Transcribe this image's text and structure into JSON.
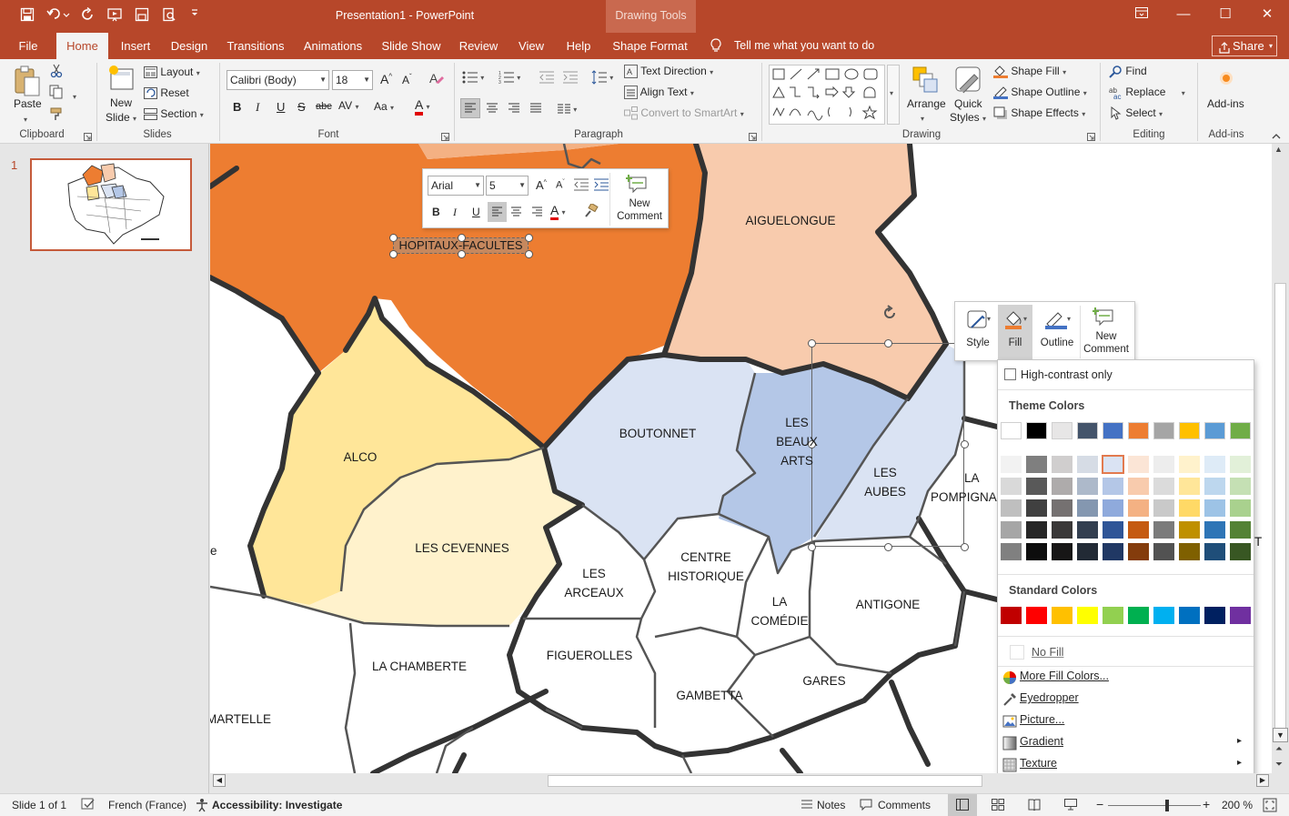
{
  "window": {
    "title": "Presentation1  -  PowerPoint",
    "context_tab_group": "Drawing Tools",
    "minimize": "—",
    "maximize": "☐",
    "close": "✕",
    "restore": "⧉"
  },
  "tabs": [
    "File",
    "Home",
    "Insert",
    "Design",
    "Transitions",
    "Animations",
    "Slide Show",
    "Review",
    "View",
    "Help",
    "Shape Format"
  ],
  "tell_me": "Tell me what you want to do",
  "share": "Share",
  "ribbon": {
    "clipboard": {
      "paste": "Paste",
      "label": "Clipboard"
    },
    "slides": {
      "new_slide_1": "New",
      "new_slide_2": "Slide",
      "layout": "Layout",
      "reset": "Reset",
      "section": "Section",
      "label": "Slides"
    },
    "font": {
      "name": "Calibri (Body)",
      "size": "18",
      "label": "Font",
      "bold": "B",
      "italic": "I",
      "underline": "U",
      "strike": "S",
      "shadow": "abc",
      "spacing": "AV",
      "case": "Aa",
      "color": "A",
      "grow": "A",
      "shrink": "A"
    },
    "paragraph": {
      "text_direction": "Text Direction",
      "align_text": "Align Text",
      "convert_smartart": "Convert to SmartArt",
      "label": "Paragraph"
    },
    "drawing": {
      "arrange": "Arrange",
      "quick_styles_1": "Quick",
      "quick_styles_2": "Styles",
      "shape_fill": "Shape Fill",
      "shape_outline": "Shape Outline",
      "shape_effects": "Shape Effects",
      "label": "Drawing"
    },
    "editing": {
      "find": "Find",
      "replace": "Replace",
      "select": "Select",
      "label": "Editing"
    },
    "addins": {
      "addins": "Add-ins",
      "label": "Add-ins"
    }
  },
  "slide_panel": {
    "number": "1"
  },
  "map": {
    "regions": [
      "AIGUELONGUE",
      "HOPITAUX-FACULTES",
      "ALCO",
      "LES CEVENNES",
      "BOUTONNET",
      "LES BEAUX ARTS",
      "LES AUBES",
      "LA POMPIGNANE",
      "LES ARCEAUX",
      "CENTRE HISTORIQUE",
      "LA COMÉDIE",
      "ANTIGONE",
      "FIGUEROLLES",
      "LA CHAMBERTE",
      "GAMBETTA",
      "GARES",
      "MARTELLE"
    ],
    "labels": {
      "aiguelongue": "AIGUELONGUE",
      "hopitaux": "HOPITAUX-FACULTES",
      "alco": "ALCO",
      "cevennes": "LES CEVENNES",
      "boutonnet": "BOUTONNET",
      "beauxarts_1": "LES",
      "beauxarts_2": "BEAUX",
      "beauxarts_3": "ARTS",
      "aubes_1": "LES",
      "aubes_2": "AUBES",
      "pompignane_1": "LA",
      "pompignane_2": "POMPIGNA",
      "arceaux_1": "LES",
      "arceaux_2": "ARCEAUX",
      "centre_1": "CENTRE",
      "centre_2": "HISTORIQUE",
      "comedie_1": "LA",
      "comedie_2": "COMÉDIE",
      "antigone": "ANTIGONE",
      "figuerolles": "FIGUEROLLES",
      "chamberte": "LA CHAMBERTE",
      "gambetta": "GAMBETTA",
      "gares": "GARES",
      "martelle": "MARTELLE",
      "edge_e": "e",
      "edge_t": "T"
    }
  },
  "mini_toolbar": {
    "font": "Arial",
    "size": "5",
    "new_comment_1": "New",
    "new_comment_2": "Comment"
  },
  "shape_toolbar": {
    "style": "Style",
    "fill": "Fill",
    "outline": "Outline",
    "new_comment_1": "New",
    "new_comment_2": "Comment"
  },
  "fill_menu": {
    "high_contrast": "High-contrast only",
    "theme_colors_header": "Theme Colors",
    "standard_colors_header": "Standard Colors",
    "no_fill": "No Fill",
    "more_fill_colors": "More Fill Colors...",
    "eyedropper": "Eyedropper",
    "picture": "Picture...",
    "gradient": "Gradient",
    "texture": "Texture",
    "theme_top": [
      "#ffffff",
      "#000000",
      "#e7e6e6",
      "#44546a",
      "#4472c4",
      "#ed7d31",
      "#a5a5a5",
      "#ffc000",
      "#5b9bd5",
      "#70ad47"
    ],
    "theme_shades": [
      [
        "#f2f2f2",
        "#d9d9d9",
        "#bfbfbf",
        "#a6a6a6",
        "#808080"
      ],
      [
        "#7f7f7f",
        "#595959",
        "#404040",
        "#262626",
        "#0d0d0d"
      ],
      [
        "#d0cece",
        "#aeabab",
        "#757171",
        "#3a3838",
        "#171616"
      ],
      [
        "#d6dce5",
        "#adb9ca",
        "#8497b0",
        "#333f50",
        "#222a35"
      ],
      [
        "#dae3f3",
        "#b4c7e7",
        "#8faadc",
        "#2f5597",
        "#203864"
      ],
      [
        "#fbe5d6",
        "#f8cbad",
        "#f4b183",
        "#c55a11",
        "#843c0c"
      ],
      [
        "#ededed",
        "#dbdbdb",
        "#c9c9c9",
        "#7b7b7b",
        "#525252"
      ],
      [
        "#fff2cc",
        "#ffe699",
        "#ffd966",
        "#bf9000",
        "#7f6000"
      ],
      [
        "#deebf7",
        "#bdd7ee",
        "#9dc3e6",
        "#2e75b6",
        "#1f4e79"
      ],
      [
        "#e2f0d9",
        "#c5e0b4",
        "#a9d18e",
        "#548235",
        "#385723"
      ]
    ],
    "standard": [
      "#c00000",
      "#ff0000",
      "#ffc000",
      "#ffff00",
      "#92d050",
      "#00b050",
      "#00b0f0",
      "#0070c0",
      "#002060",
      "#7030a0"
    ]
  },
  "status": {
    "slide": "Slide 1 of 1",
    "language": "French (France)",
    "accessibility": "Accessibility: Investigate",
    "notes": "Notes",
    "comments": "Comments",
    "zoom": "200 %",
    "zoom_minus": "−",
    "zoom_plus": "+"
  },
  "colors": {
    "accent": "#b7472a",
    "orange": "#ed7d31",
    "peach": "#f8cbad",
    "light_peach": "#fbe5d6",
    "yellow": "#ffe699",
    "light_yellow": "#fff2cc",
    "light_blue": "#dae3f3",
    "blue": "#b4c7e7"
  }
}
